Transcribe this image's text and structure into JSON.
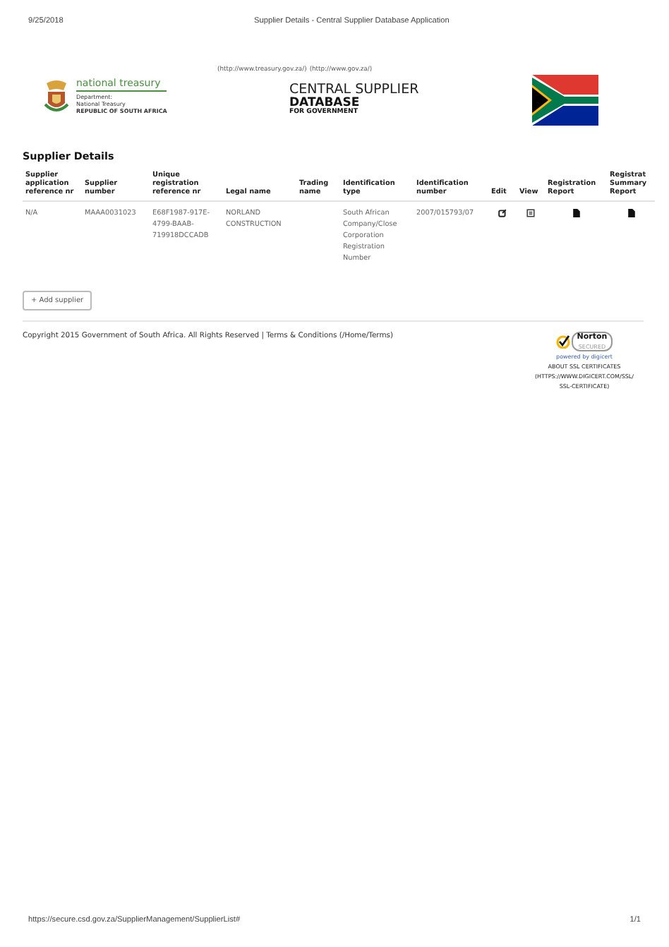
{
  "print_header": {
    "date": "9/25/2018",
    "title": "Supplier Details - Central Supplier Database Application"
  },
  "site_links": [
    "(http://www.treasury.gov.za/)",
    "(http://www.gov.za/)"
  ],
  "logo": {
    "name": "national treasury",
    "lines": [
      "Department:",
      "National Treasury",
      "REPUBLIC OF SOUTH AFRICA"
    ]
  },
  "brand": {
    "line1": "CENTRAL SUPPLIER",
    "line2": "DATABASE",
    "line3": "FOR GOVERNMENT"
  },
  "heading": "Supplier Details",
  "table": {
    "columns": [
      {
        "label": "Supplier application reference nr",
        "kind": "text"
      },
      {
        "label": "Supplier number",
        "kind": "text"
      },
      {
        "label": "Unique registration reference nr",
        "kind": "text"
      },
      {
        "label": "Legal name",
        "kind": "text"
      },
      {
        "label": "Trading name",
        "kind": "text"
      },
      {
        "label": "Identification type",
        "kind": "text"
      },
      {
        "label": "Identification number",
        "kind": "text"
      },
      {
        "label": "Edit",
        "kind": "edit"
      },
      {
        "label": "View",
        "kind": "view"
      },
      {
        "label": "Registration Report",
        "kind": "report"
      },
      {
        "label": "Registrat Summary Report",
        "kind": "report"
      }
    ],
    "rows": [
      {
        "cells": [
          "N/A",
          "MAAA0031023",
          "E68F1987-917E-4799-BAAB-719918DCCADB",
          "NORLAND CONSTRUCTION",
          "",
          "South African Company/Close Corporation Registration Number",
          "2007/015793/07"
        ]
      }
    ]
  },
  "add_button": "+ Add supplier",
  "footer": {
    "copyright": "Copyright 2015 Government of South Africa. All Rights Reserved |",
    "terms_link": "Terms & Conditions (/Home/Terms)",
    "badge": {
      "name": "Norton",
      "sub": "SECURED",
      "powered": "powered by digicert",
      "about": [
        "ABOUT SSL CERTIFICATES",
        "(HTTPS://WWW.DIGICERT.COM/SSL/",
        "SSL-CERTIFICATE)"
      ]
    }
  },
  "print_footer": {
    "url": "https://secure.csd.gov.za/SupplierManagement/SupplierList#",
    "page": "1/1"
  }
}
